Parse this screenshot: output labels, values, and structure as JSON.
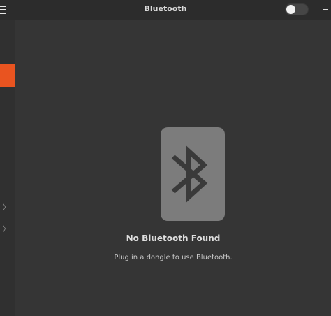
{
  "header": {
    "title": "Bluetooth",
    "toggle_on": false
  },
  "sidebar": {
    "selected_accent": "#e95420",
    "chevron_glyph": "〉"
  },
  "main": {
    "icon": "bluetooth-icon",
    "headline": "No Bluetooth Found",
    "subtitle": "Plug in a dongle to use Bluetooth."
  }
}
